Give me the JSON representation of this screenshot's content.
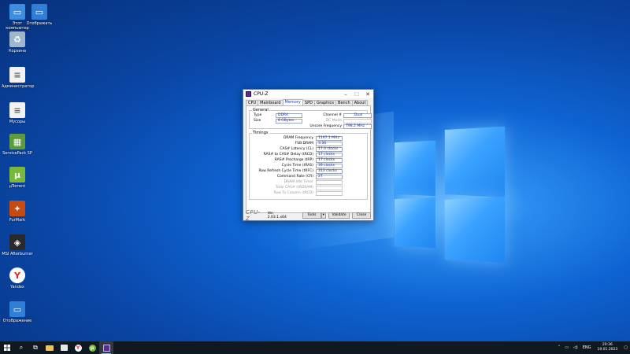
{
  "desktop": {
    "icons": [
      {
        "label": "Этот компьютер",
        "icon": "computer-icon",
        "color": "#3d8ee0"
      },
      {
        "label": "Отображать",
        "icon": "monitor-icon",
        "color": "#2f7fd8"
      },
      {
        "label": "Корзина",
        "icon": "recycle-bin-icon",
        "color": "#9fb7cc"
      },
      {
        "label": "Администратор",
        "icon": "document-icon",
        "color": "#f2f2f2"
      },
      {
        "label": "Мусоры",
        "icon": "document-icon",
        "color": "#f2f2f2"
      },
      {
        "label": "ServicePack SP",
        "icon": "chip-icon",
        "color": "#5e9b3d"
      },
      {
        "label": "µTorrent",
        "icon": "utorrent-icon",
        "color": "#78b83a"
      },
      {
        "label": "FurMark",
        "icon": "furmark-icon",
        "color": "#c84a10"
      },
      {
        "label": "MSI Afterburner",
        "icon": "msi-icon",
        "color": "#2a2a2a"
      },
      {
        "label": "Yandex",
        "icon": "yandex-icon",
        "color": "#ffffff"
      },
      {
        "label": "Отображение",
        "icon": "monitor-icon",
        "color": "#2f7fd8"
      }
    ]
  },
  "window": {
    "title": "CPU-Z",
    "tabs": [
      "CPU",
      "Mainboard",
      "Memory",
      "SPD",
      "Graphics",
      "Bench",
      "About"
    ],
    "active_tab": "Memory",
    "general": {
      "legend": "General",
      "type_label": "Type",
      "type_value": "DDR4",
      "size_label": "Size",
      "size_value": "8 GBytes",
      "channel_label": "Channel #",
      "channel_value": "Dual",
      "dc_mode_label": "DC Mode",
      "dc_mode_value": "",
      "uncore_label": "Uncore Frequency",
      "uncore_value": "798.2 MHz"
    },
    "timings": {
      "legend": "Timings",
      "rows": [
        {
          "label": "DRAM Frequency",
          "value": "1197.1 MHz",
          "disabled": false
        },
        {
          "label": "FSB:DRAM",
          "value": "3:36",
          "disabled": false
        },
        {
          "label": "CAS# Latency (CL)",
          "value": "17.0 clocks",
          "disabled": false
        },
        {
          "label": "RAS# to CAS# Delay (tRCD)",
          "value": "17 clocks",
          "disabled": false
        },
        {
          "label": "RAS# Precharge (tRP)",
          "value": "17 clocks",
          "disabled": false
        },
        {
          "label": "Cycle Time (tRAS)",
          "value": "39 clocks",
          "disabled": false
        },
        {
          "label": "Row Refresh Cycle Time (tRFC)",
          "value": "313 clocks",
          "disabled": false
        },
        {
          "label": "Command Rate (CR)",
          "value": "2T",
          "disabled": false
        },
        {
          "label": "DRAM Idle Timer",
          "value": "",
          "disabled": true
        },
        {
          "label": "Total CAS# (tRDRAM)",
          "value": "",
          "disabled": true
        },
        {
          "label": "Row To Column (tRCD)",
          "value": "",
          "disabled": true
        }
      ]
    },
    "bottom": {
      "brand": "CPU-Z",
      "version": "Ver. 2.03.1.x64",
      "tools": "Tools",
      "validate": "Validate",
      "close": "Close"
    }
  },
  "taskbar": {
    "lang": "ENG",
    "time": "20:36",
    "date": "19.01.2023"
  }
}
